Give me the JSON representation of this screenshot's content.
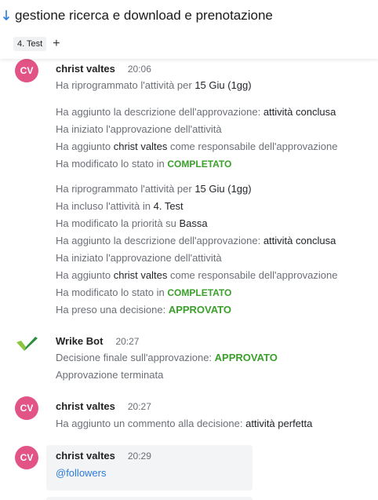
{
  "header": {
    "title": "gestione ricerca e download e prenotazione",
    "tag": "4. Test",
    "add_label": "+"
  },
  "entries": [
    {
      "avatar": "CV",
      "author": "christ valtes",
      "time": "20:06",
      "lines": [
        {
          "prefix": "Ha riprogrammato l'attività per ",
          "value": "15 Giu (1gg)"
        },
        {
          "prefix": "Ha aggiunto la descrizione dell'approvazione: ",
          "value": "attività conclusa"
        },
        {
          "prefix": "Ha iniziato l'approvazione dell'attività"
        },
        {
          "prefix": "Ha aggiunto ",
          "value": "christ valtes",
          "suffix": " come responsabile dell'approvazione"
        },
        {
          "prefix": "Ha modificato lo stato in ",
          "value": "COMPLETATO"
        },
        {
          "prefix": "Ha riprogrammato l'attività per ",
          "value": "15 Giu (1gg)"
        },
        {
          "prefix": "Ha incluso l'attività in ",
          "value": "4. Test"
        },
        {
          "prefix": "Ha modificato la priorità su ",
          "value": "Bassa"
        },
        {
          "prefix": "Ha aggiunto la descrizione dell'approvazione: ",
          "value": "attività conclusa"
        },
        {
          "prefix": "Ha iniziato l'approvazione dell'attività"
        },
        {
          "prefix": "Ha aggiunto ",
          "value": "christ valtes",
          "suffix": " come responsabile dell'approvazione"
        },
        {
          "prefix": "Ha modificato lo stato in ",
          "value": "COMPLETATO"
        },
        {
          "prefix": "Ha preso una decisione: ",
          "value": "APPROVATO"
        }
      ]
    },
    {
      "avatar_icon": "check-icon",
      "author": "Wrike Bot",
      "time": "20:27",
      "lines": [
        {
          "prefix": "Decisione finale sull'approvazione: ",
          "value": "APPROVATO"
        },
        {
          "prefix": "Approvazione terminata"
        }
      ]
    },
    {
      "avatar": "CV",
      "author": "christ valtes",
      "time": "20:27",
      "lines": [
        {
          "prefix": "Ha aggiunto un commento alla decisione: ",
          "value": "attività perfetta"
        }
      ]
    },
    {
      "avatar": "CV",
      "author": "christ valtes",
      "time": "20:29",
      "lines": [
        {
          "value": "@followers"
        }
      ]
    }
  ],
  "colors": {
    "avatar": "#e35486",
    "status_green": "#3aa02a",
    "mention_blue": "#2b7bd8"
  }
}
